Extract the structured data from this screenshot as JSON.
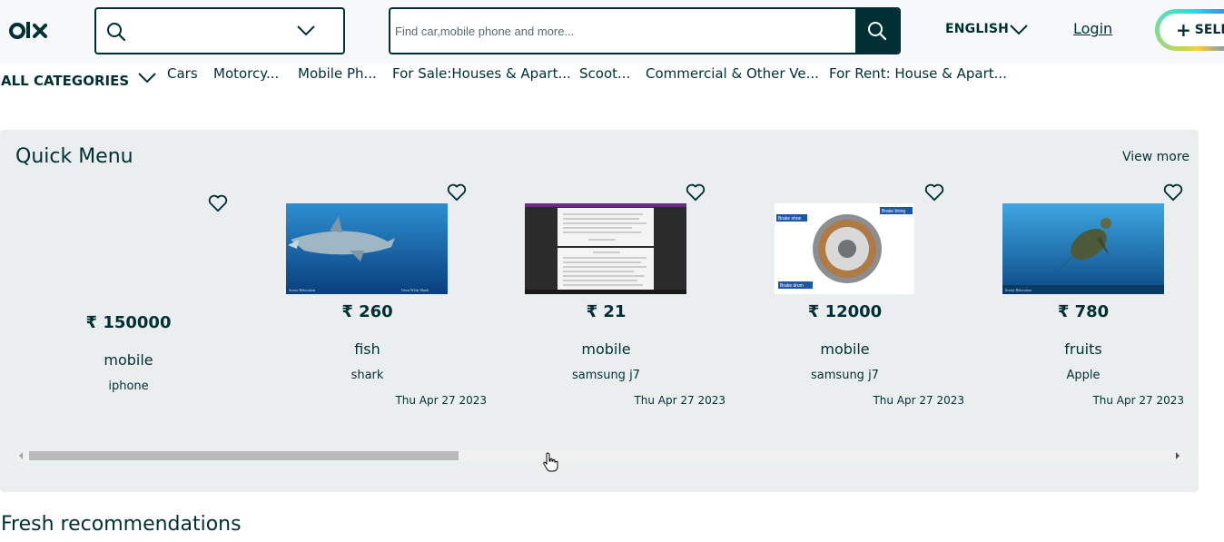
{
  "header": {
    "logo_text": "OLX",
    "search_placeholder": "Find car,mobile phone and more...",
    "language": "ENGLISH",
    "login": "Login",
    "sell": "SELL"
  },
  "categories": {
    "all": "ALL CATEGORIES",
    "items": [
      "Cars",
      "Motorcy...",
      "Mobile Ph...",
      "For Sale:Houses & Apart...",
      "Scoot...",
      "Commercial & Other Ve...",
      "For Rent: House & Apart..."
    ]
  },
  "quick_menu": {
    "title": "Quick Menu",
    "view_more": "View more",
    "scroll_position": 0.36,
    "cards": [
      {
        "price": "₹ 150000",
        "name": "mobile",
        "desc": "iphone",
        "date": "",
        "image": "none"
      },
      {
        "price": "₹ 260",
        "name": "fish",
        "desc": "shark",
        "date": "Thu Apr 27 2023",
        "image": "shark-photo",
        "caption_left": "Scenic Relocation",
        "caption_right": "Great White Shark"
      },
      {
        "price": "₹ 21",
        "name": "mobile",
        "desc": "samsung j7",
        "date": "Thu Apr 27 2023",
        "image": "document-screenshot"
      },
      {
        "price": "₹ 12000",
        "name": "mobile",
        "desc": "samsung j7",
        "date": "Thu Apr 27 2023",
        "image": "brake-diagram",
        "labels": [
          "Brake shoe",
          "Brake lining",
          "Brake drum"
        ]
      },
      {
        "price": "₹ 780",
        "name": "fruits",
        "desc": "Apple",
        "date": "Thu Apr 27 2023",
        "image": "turtle-photo",
        "caption_left": "Scenic Relocation"
      }
    ]
  },
  "fresh": {
    "title": "Fresh recommendations"
  },
  "colors": {
    "brand": "#002f34",
    "panel": "#ebeeef"
  }
}
